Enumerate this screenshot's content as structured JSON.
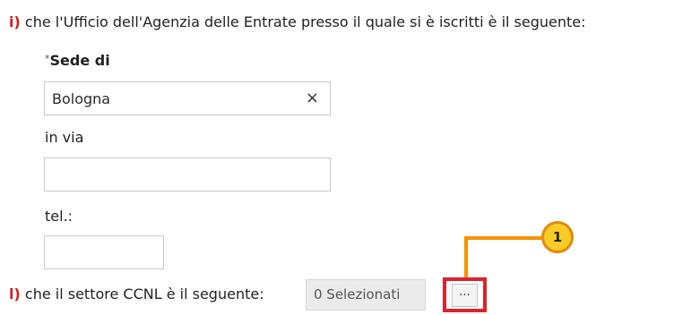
{
  "section_i": {
    "marker": "i)",
    "text": "che l'Ufficio dell'Agenzia delle Entrate presso il quale si è iscritti è il seguente:"
  },
  "sede": {
    "required_mark": "*",
    "label": "Sede di",
    "value": "Bologna",
    "clear_icon": "×"
  },
  "via": {
    "label": "in via",
    "value": ""
  },
  "tel": {
    "label": "tel.:",
    "value": ""
  },
  "section_l": {
    "marker": "l)",
    "text": "che il settore CCNL è il seguente:",
    "select_value": "0 Selezionati",
    "button_label": "..."
  },
  "annotation": {
    "badge_number": "1",
    "highlight_color": "#d9232d",
    "callout_color": "#f39200",
    "badge_color": "#f9cc25"
  }
}
